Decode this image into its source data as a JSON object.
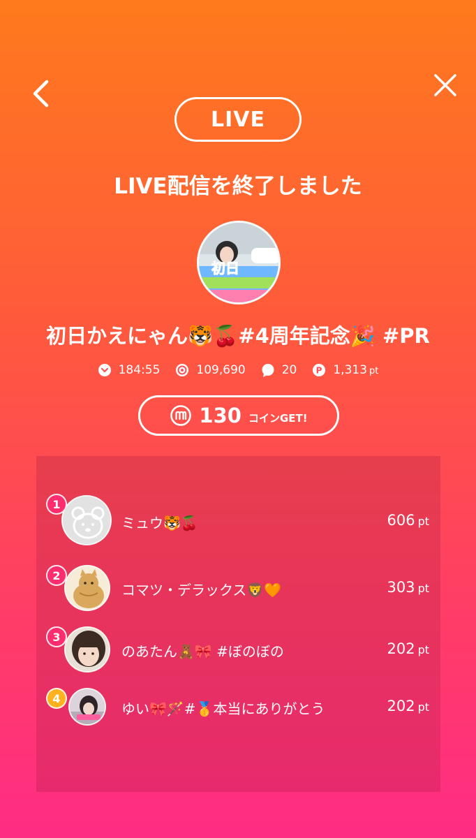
{
  "nav": {
    "back_icon": "chevron-left-icon",
    "close_icon": "close-icon"
  },
  "live_badge": "LIVE",
  "end_message": "LIVE配信を終了しました",
  "stream": {
    "thumbnail_text": "初日",
    "title": "初日かえにゃん🐯🍒#4周年記念🎉 #PR"
  },
  "stats": [
    {
      "icon": "duration-icon",
      "value": "184:55",
      "unit": ""
    },
    {
      "icon": "views-icon",
      "value": "109,690",
      "unit": ""
    },
    {
      "icon": "comment-icon",
      "value": "20",
      "unit": ""
    },
    {
      "icon": "points-icon",
      "value": "1,313",
      "unit": "pt"
    }
  ],
  "coin": {
    "icon": "m-coin-icon",
    "amount": "130",
    "label": "コインGET!"
  },
  "ranking": [
    {
      "rank": "1",
      "name": "ミュウ🐯🍒",
      "points": "606",
      "unit": "pt",
      "avatar": "default-bear-avatar"
    },
    {
      "rank": "2",
      "name": "コマツ・デラックス🦁🧡",
      "points": "303",
      "unit": "pt",
      "avatar": "cat-illustration-avatar"
    },
    {
      "rank": "3",
      "name": "のあたん🧸🎀 #ぼのぼの",
      "points": "202",
      "unit": "pt",
      "avatar": "photo-avatar"
    },
    {
      "rank": "4",
      "name": "ゆい🎀🪄#🥇本当にありがとう",
      "points": "202",
      "unit": "pt",
      "avatar": "photo-avatar"
    }
  ],
  "colors": {
    "gradient_top": "#ff7a1c",
    "gradient_bottom": "#ff2c84",
    "rank_1": "#ff2d6e",
    "rank_2": "#ff2d6e",
    "rank_3": "#ff2d6e",
    "rank_4": "#ffb21f"
  }
}
